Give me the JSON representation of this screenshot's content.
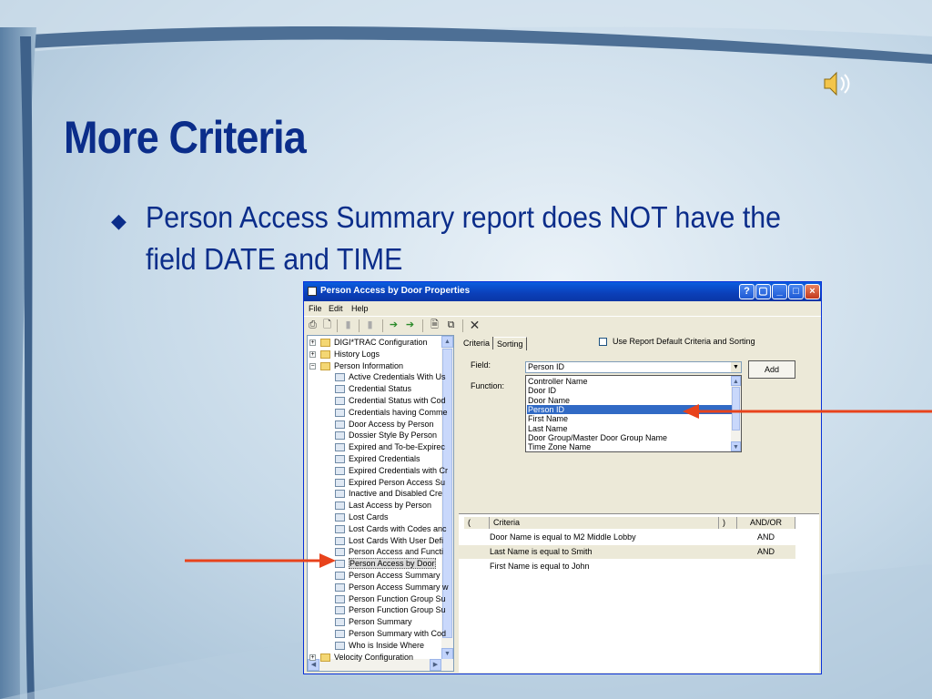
{
  "slide": {
    "title": "More Criteria",
    "bullet": "Person Access Summary report does NOT have the field DATE and TIME",
    "bullet_marker": "◆",
    "sound_icon": "speaker-icon"
  },
  "window": {
    "title": "Person Access by Door Properties",
    "menus": [
      "File",
      "Edit",
      "Help"
    ],
    "toolbar_icons": [
      "print-icon",
      "preview-icon",
      "page-icon",
      "page-icon",
      "add-icon",
      "add-all-icon",
      "report-icon",
      "export-icon",
      "delete-icon"
    ],
    "title_buttons": [
      "help-button",
      "restore-button",
      "minimize-button",
      "maximize-button",
      "close-button"
    ],
    "tree": [
      {
        "label": "DIGI*TRAC Configuration",
        "level": 0,
        "type": "folder",
        "expander": "+"
      },
      {
        "label": "History Logs",
        "level": 0,
        "type": "folder",
        "expander": "+"
      },
      {
        "label": "Person Information",
        "level": 0,
        "type": "folder",
        "expander": "−"
      },
      {
        "label": "Active Credentials With Us",
        "level": 1,
        "type": "report"
      },
      {
        "label": "Credential Status",
        "level": 1,
        "type": "report"
      },
      {
        "label": "Credential Status with Cod",
        "level": 1,
        "type": "report"
      },
      {
        "label": "Credentials having Comme",
        "level": 1,
        "type": "report"
      },
      {
        "label": "Door Access by Person",
        "level": 1,
        "type": "report"
      },
      {
        "label": "Dossier Style By Person",
        "level": 1,
        "type": "report"
      },
      {
        "label": "Expired and To-be-Expirec",
        "level": 1,
        "type": "report"
      },
      {
        "label": "Expired Credentials",
        "level": 1,
        "type": "report"
      },
      {
        "label": "Expired Credentials with Cr",
        "level": 1,
        "type": "report"
      },
      {
        "label": "Expired Person Access Su",
        "level": 1,
        "type": "report"
      },
      {
        "label": "Inactive and Disabled Cre",
        "level": 1,
        "type": "report"
      },
      {
        "label": "Last Access by Person",
        "level": 1,
        "type": "report"
      },
      {
        "label": "Lost Cards",
        "level": 1,
        "type": "report"
      },
      {
        "label": "Lost Cards with Codes anc",
        "level": 1,
        "type": "report"
      },
      {
        "label": "Lost Cards With User Defi",
        "level": 1,
        "type": "report"
      },
      {
        "label": "Person Access and Functi",
        "level": 1,
        "type": "report"
      },
      {
        "label": "Person Access by Door",
        "level": 1,
        "type": "report",
        "selected": true
      },
      {
        "label": "Person Access Summary",
        "level": 1,
        "type": "report"
      },
      {
        "label": "Person Access Summary w",
        "level": 1,
        "type": "report"
      },
      {
        "label": "Person Function Group Su",
        "level": 1,
        "type": "report"
      },
      {
        "label": "Person Function Group Su",
        "level": 1,
        "type": "report"
      },
      {
        "label": "Person Summary",
        "level": 1,
        "type": "report"
      },
      {
        "label": "Person Summary with Cod",
        "level": 1,
        "type": "report"
      },
      {
        "label": "Who is Inside Where",
        "level": 1,
        "type": "report"
      },
      {
        "label": "Velocity Configuration",
        "level": 0,
        "type": "folder",
        "expander": "+"
      }
    ],
    "tabs": [
      "Criteria",
      "Sorting"
    ],
    "use_default_label": "Use Report Default Criteria and Sorting",
    "field_label": "Field:",
    "function_label": "Function:",
    "field_value": "Person ID",
    "add_label": "Add",
    "field_options": [
      "Controller Name",
      "Door ID",
      "Door Name",
      "Person ID",
      "First Name",
      "Last Name",
      "Door Group/Master Door Group Name",
      "Time Zone Name"
    ],
    "selected_option": "Person ID",
    "grid_headers": [
      "(",
      "Criteria",
      ")",
      "AND/OR"
    ],
    "grid_rows": [
      {
        "criteria": "Door Name is equal to M2 Middle Lobby",
        "andor": "AND"
      },
      {
        "criteria": "Last Name is equal to Smith",
        "andor": "AND"
      },
      {
        "criteria": "First Name is equal to John",
        "andor": ""
      }
    ]
  }
}
